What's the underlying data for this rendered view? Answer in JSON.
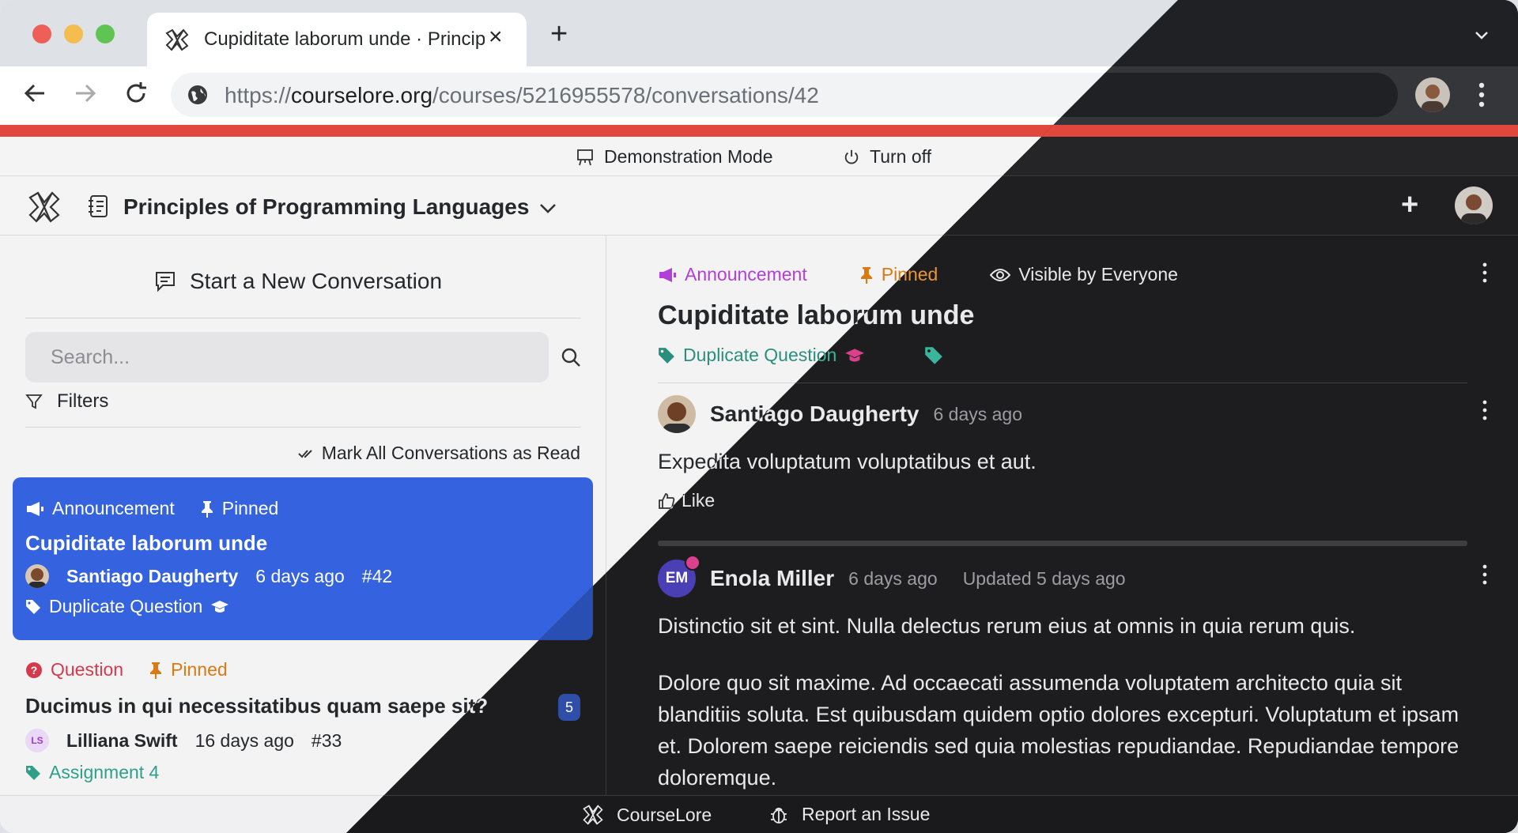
{
  "browser": {
    "tab_title": "Cupiditate laborum unde · Principles of Programming Languages",
    "url_scheme": "https://",
    "url_host": "courselore.org",
    "url_path": "/courses/5216955578/conversations/42"
  },
  "demo_bar": {
    "mode_label": "Demonstration Mode",
    "turn_off_label": "Turn off"
  },
  "course": {
    "title": "Principles of Programming Languages"
  },
  "sidebar": {
    "new_conversation_label": "Start a New Conversation",
    "search_placeholder": "Search...",
    "filters_label": "Filters",
    "mark_read_label": "Mark All Conversations as Read",
    "conversations": [
      {
        "type": "Announcement",
        "pinned": "Pinned",
        "title": "Cupiditate laborum unde",
        "author": "Santiago Daugherty",
        "time": "6 days ago",
        "number": "#42",
        "tag": "Duplicate Question"
      },
      {
        "type": "Question",
        "pinned": "Pinned",
        "title": "Ducimus in qui necessitatibus quam saepe sit?",
        "author": "Lilliana Swift",
        "author_initials": "LS",
        "time": "16 days ago",
        "number": "#33",
        "tag": "Assignment 4",
        "unread_count": "5"
      }
    ]
  },
  "conversation": {
    "type": "Announcement",
    "pinned": "Pinned",
    "visibility": "Visible by Everyone",
    "title": "Cupiditate laborum unde",
    "tag": "Duplicate Question",
    "posts": [
      {
        "author": "Santiago Daugherty",
        "time": "6 days ago",
        "body": "Expedita voluptatum voluptatibus et aut.",
        "like_label": "Like"
      },
      {
        "author": "Enola Miller",
        "author_initials": "EM",
        "time": "6 days ago",
        "updated": "Updated 5 days ago",
        "body_1": "Distinctio sit et sint. Nulla delectus rerum eius at omnis in quia rerum quis.",
        "body_2": "Dolore quo sit maxime. Ad occaecati assumenda voluptatem architecto quia sit blanditiis soluta. Est quibusdam quidem optio dolores excepturi. Voluptatum et ipsam et. Dolorem saepe reiciendis sed quia molestias repudiandae. Repudiandae tempore doloremque."
      }
    ]
  },
  "footer": {
    "brand_label": "CourseLore",
    "report_label": "Report an Issue"
  },
  "colors": {
    "accent_stripe": "#e0483e",
    "selected_conversation": "#3563e0",
    "announcement": "#b240d6",
    "pinned": "#d97a12",
    "question": "#d53a4c",
    "tag": "#2f9f89"
  }
}
